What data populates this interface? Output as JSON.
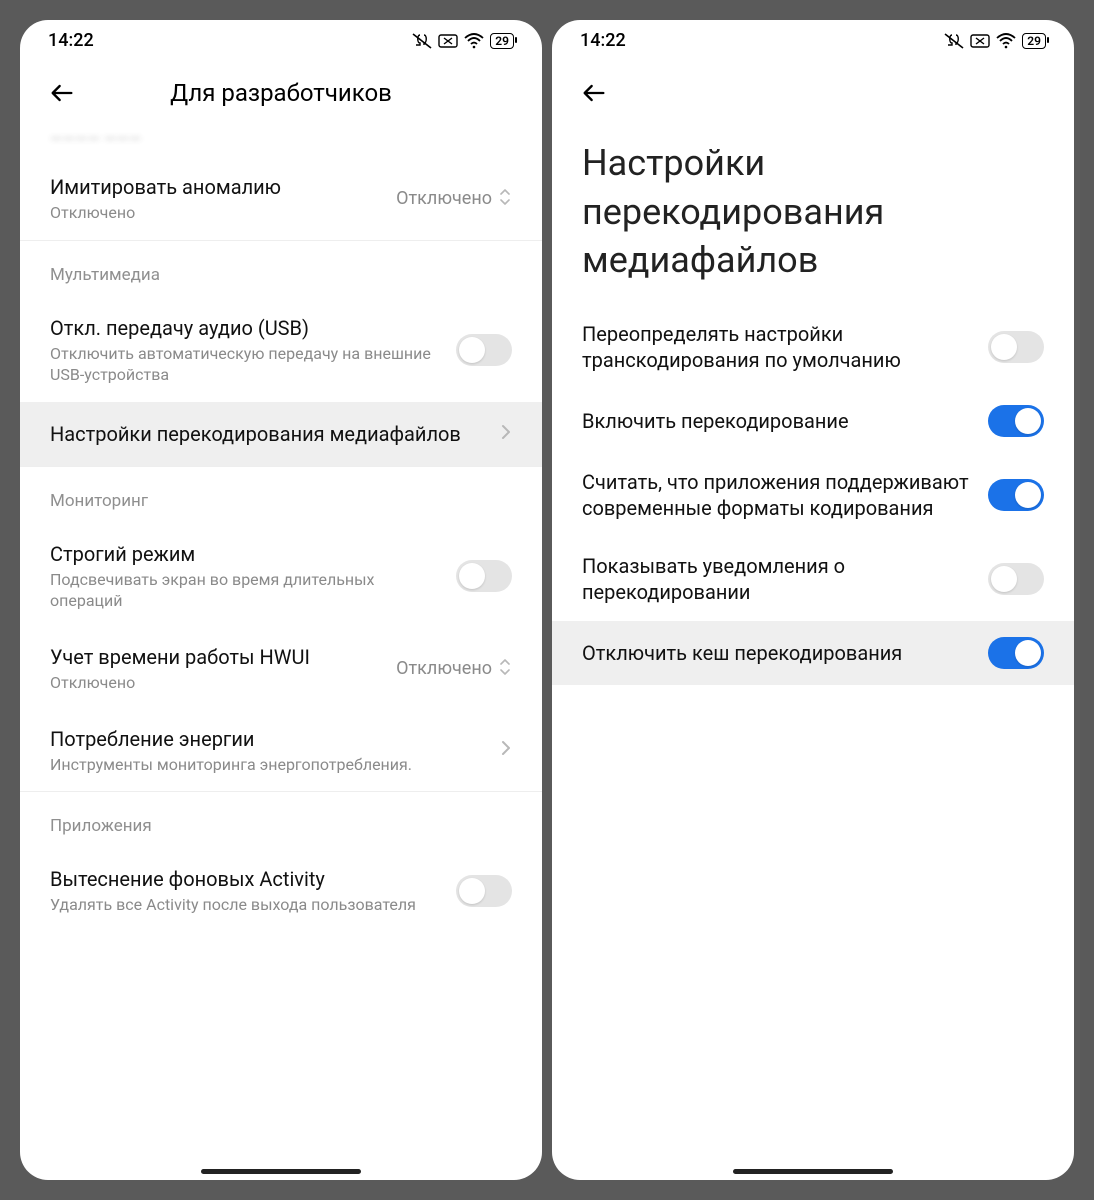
{
  "status": {
    "time": "14:22",
    "battery": "29"
  },
  "left": {
    "header_title": "Для разработчиков",
    "anomaly": {
      "title": "Имитировать аномалию",
      "sub": "Отключено",
      "value": "Отключено"
    },
    "sections": {
      "multimedia": {
        "label": "Мультимедиа",
        "usb_audio": {
          "title": "Откл. передачу аудио (USB)",
          "sub": "Отключить автоматическую передачу на внешние USB-устройства"
        },
        "transcode": {
          "title": "Настройки перекодирования медиафайлов"
        }
      },
      "monitoring": {
        "label": "Мониторинг",
        "strict": {
          "title": "Строгий режим",
          "sub": "Подсвечивать экран во время длительных операций"
        },
        "hwui": {
          "title": "Учет времени работы HWUI",
          "sub": "Отключено",
          "value": "Отключено"
        },
        "power": {
          "title": "Потребление энергии",
          "sub": "Инструменты мониторинга энергопотребления."
        }
      },
      "apps": {
        "label": "Приложения",
        "bg_activity": {
          "title": "Вытеснение фоновых Activity",
          "sub": "Удалять все Activity после выхода пользователя"
        }
      }
    }
  },
  "right": {
    "big_title": "Настройки перекодирования медиафайлов",
    "items": {
      "override": {
        "title": "Переопределять настройки транскодирования по умолчанию",
        "on": false
      },
      "enable": {
        "title": "Включить перекодирование",
        "on": true
      },
      "assume": {
        "title": "Считать, что приложения поддерживают современные форматы кодирования",
        "on": true
      },
      "notify": {
        "title": "Показывать уведомления о перекодировании",
        "on": false
      },
      "cache": {
        "title": "Отключить кеш перекодирования",
        "on": true
      }
    }
  }
}
